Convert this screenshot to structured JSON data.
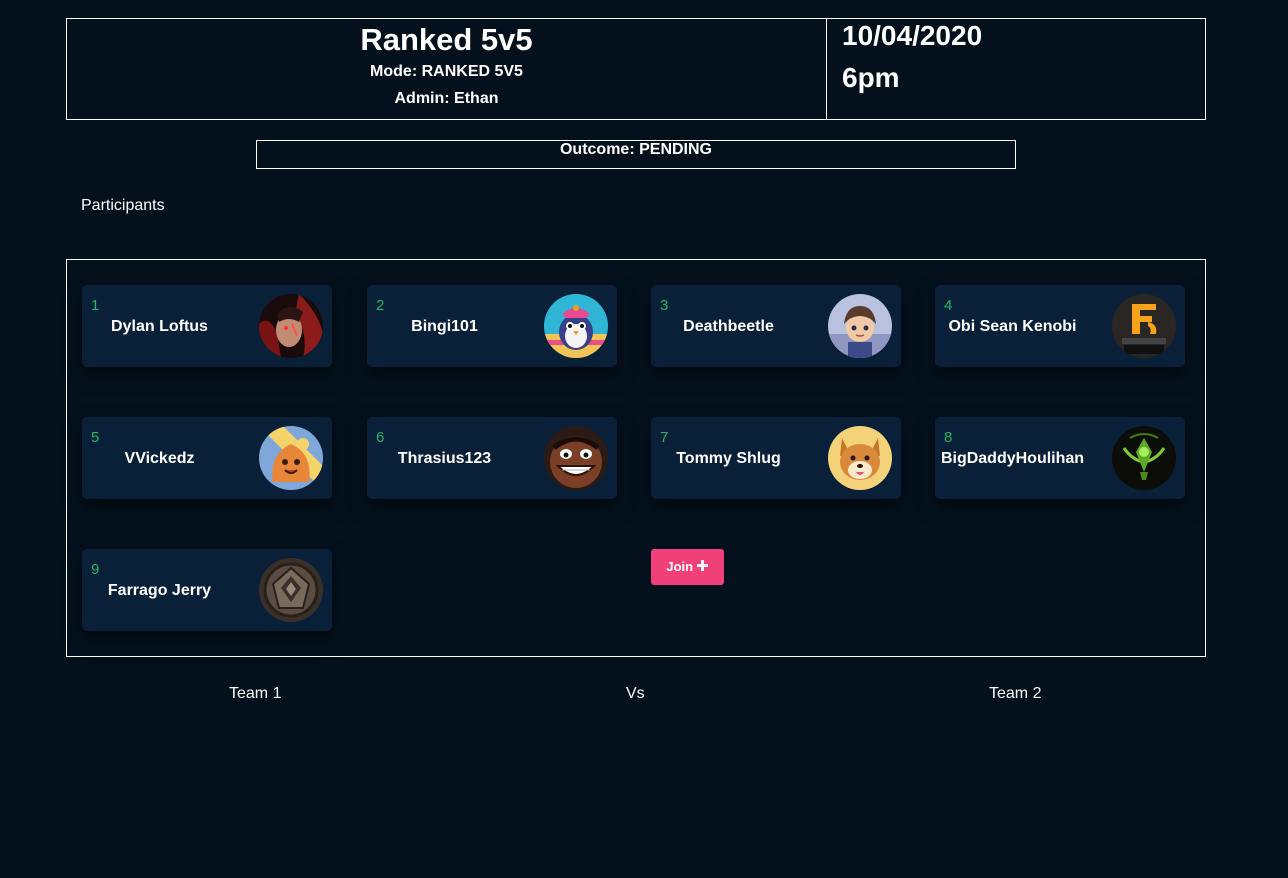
{
  "match": {
    "title": "Ranked 5v5",
    "mode_line": "Mode: RANKED 5V5",
    "admin_line": "Admin: Ethan",
    "date": "10/04/2020",
    "time": "6pm"
  },
  "outcome": "Outcome: PENDING",
  "participants_heading": "Participants",
  "players": [
    {
      "number": "1",
      "name": "Dylan Loftus",
      "avatar": "champion-portrait-red"
    },
    {
      "number": "2",
      "name": "Bingi101",
      "avatar": "penguin-icon"
    },
    {
      "number": "3",
      "name": "Deathbeetle",
      "avatar": "chibi-champion-icon"
    },
    {
      "number": "4",
      "name": "Obi Sean Kenobi",
      "avatar": "fnatic-2015-logo"
    },
    {
      "number": "5",
      "name": "VVickedz",
      "avatar": "poro-snack-icon"
    },
    {
      "number": "6",
      "name": "Thrasius123",
      "avatar": "grinning-face-icon"
    },
    {
      "number": "7",
      "name": "Tommy Shlug",
      "avatar": "shiba-dog-icon"
    },
    {
      "number": "8",
      "name": "BigDaddyHoulihan",
      "avatar": "green-emblem-icon"
    },
    {
      "number": "9",
      "name": "Farrago Jerry",
      "avatar": "stone-crest-icon"
    }
  ],
  "join_button": {
    "label": "Join",
    "icon": "plus-icon"
  },
  "teams": {
    "team1": "Team 1",
    "vs": "Vs",
    "team2": "Team 2"
  },
  "colors": {
    "background": "#04111d",
    "card": "#0a2038",
    "number": "#28b463",
    "join": "#f0407a"
  }
}
